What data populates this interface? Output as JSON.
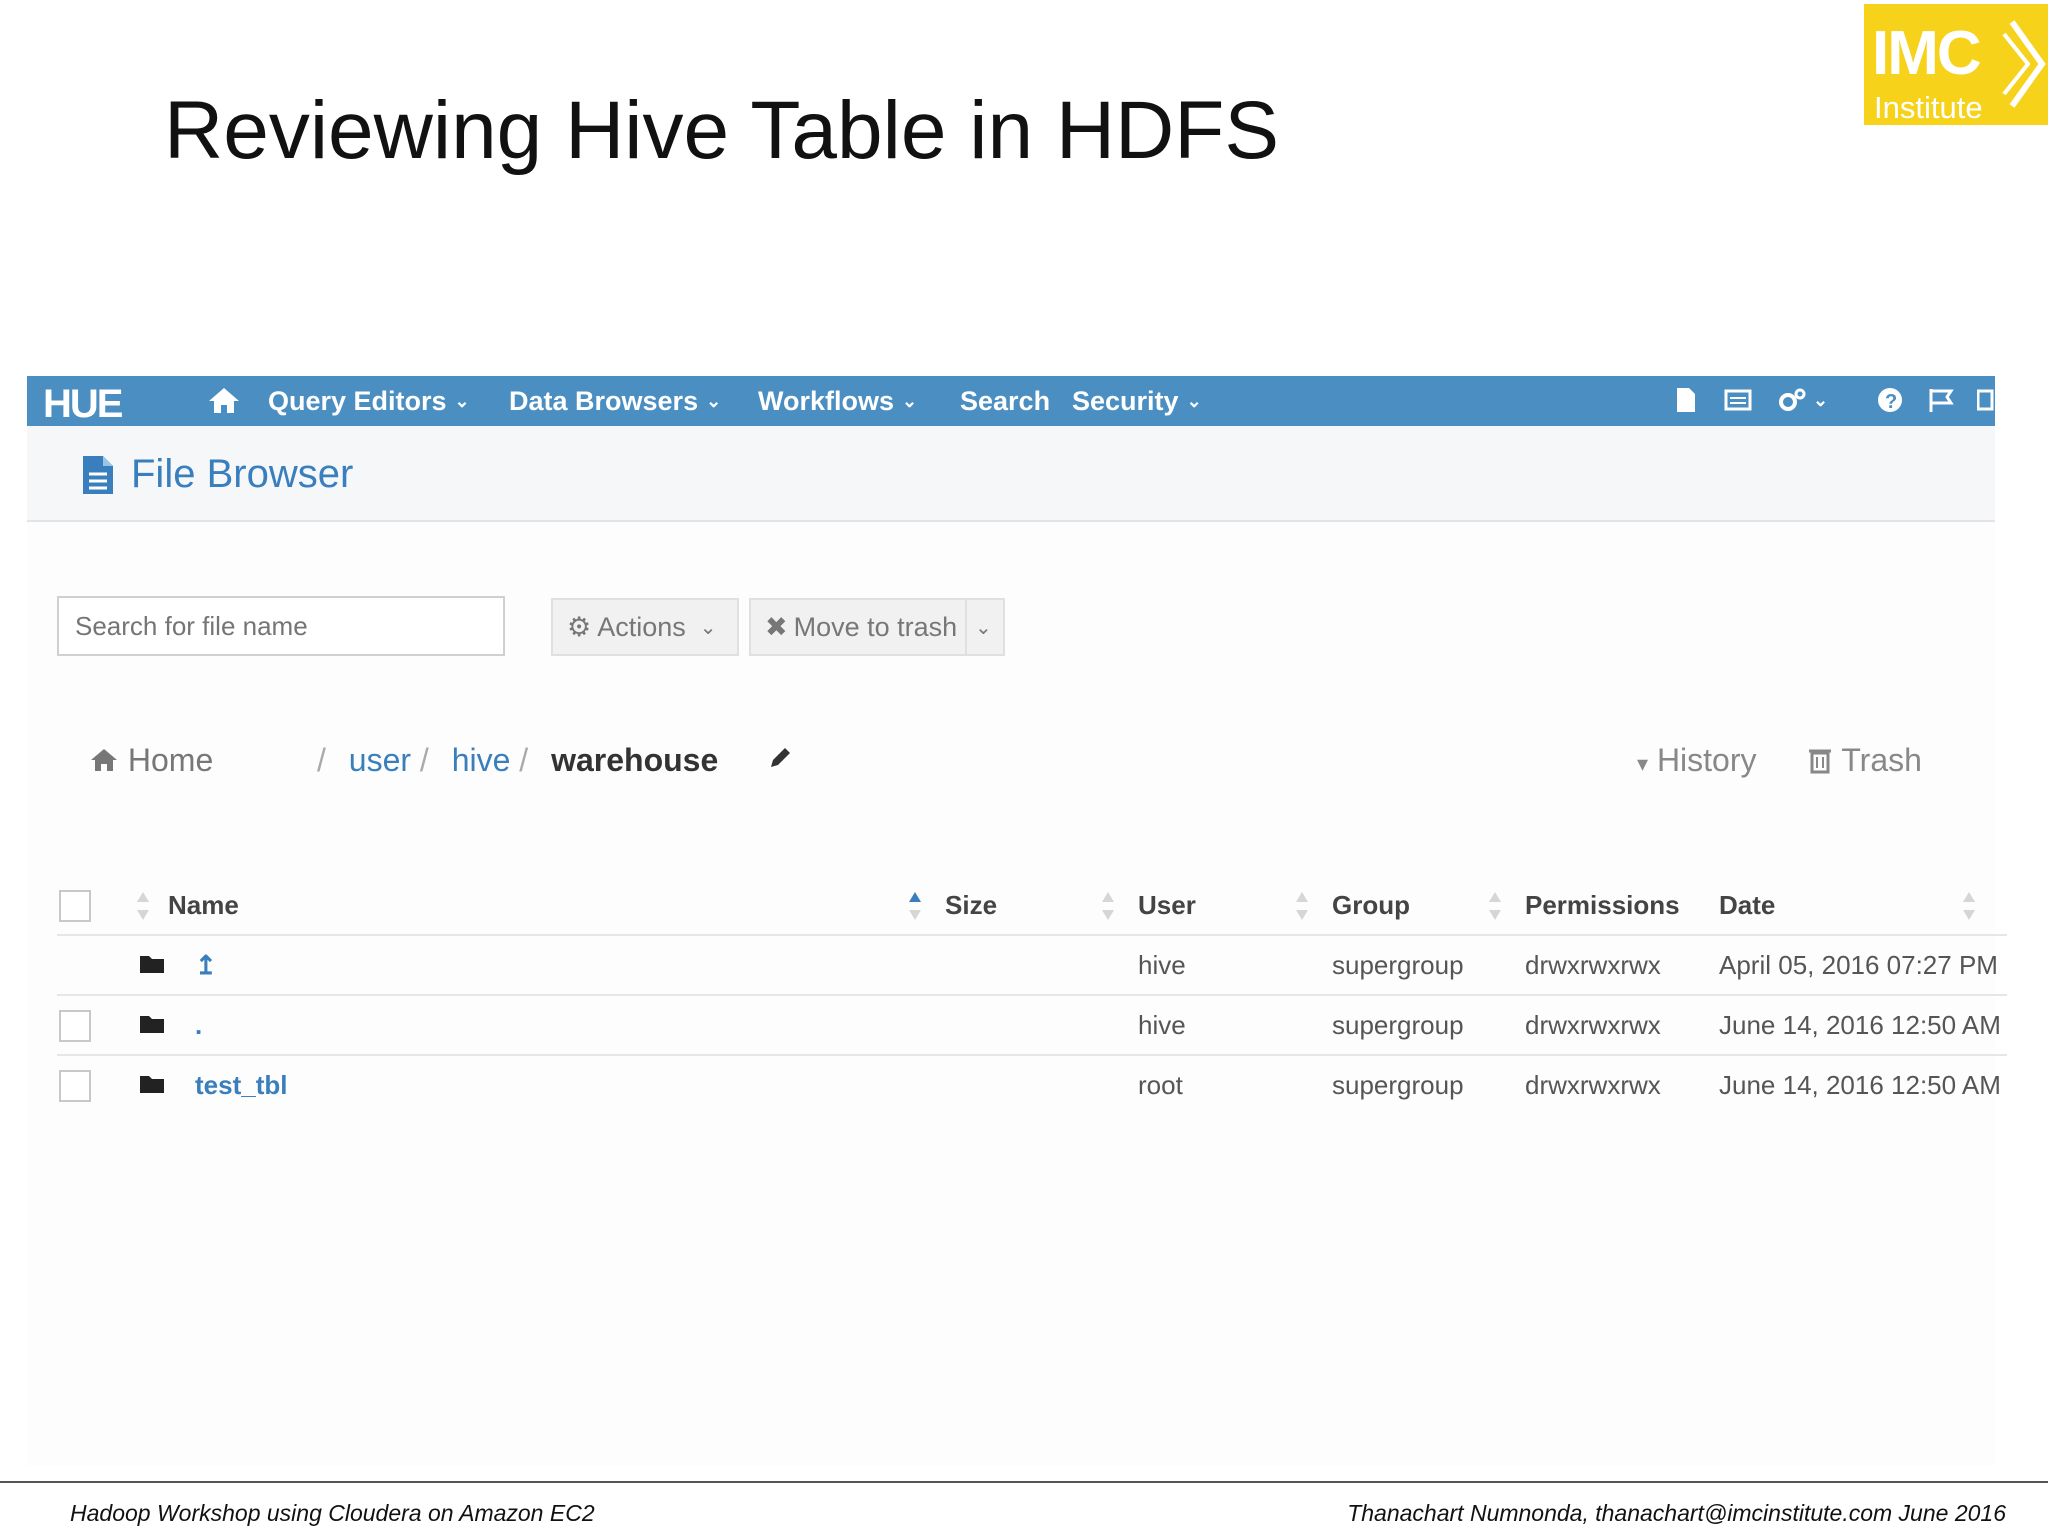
{
  "slide": {
    "title": "Reviewing Hive Table in HDFS",
    "logo_main": "IMC",
    "logo_sub": "Institute",
    "footer_left": "Hadoop Workshop using Cloudera on Amazon EC2",
    "footer_right": "Thanachart Numnonda,  thanachart@imcinstitute.com  June 2016"
  },
  "colors": {
    "nav_bg": "#4a8ec2",
    "link": "#3a7fbd",
    "logo_bg": "#f7d21a"
  },
  "navbar": {
    "brand": "HUE",
    "items": [
      "Query Editors",
      "Data Browsers",
      "Workflows",
      "Search",
      "Security"
    ],
    "icons": [
      "home-icon",
      "file-icon",
      "monitor-icon",
      "cogs-icon",
      "help-icon",
      "flag-icon",
      "logout-icon"
    ]
  },
  "file_browser": {
    "title": "File Browser",
    "search_placeholder": "Search for file name",
    "actions_label": "Actions",
    "move_to_trash_label": "Move to trash",
    "breadcrumb": {
      "home": "Home",
      "sep": "/",
      "parts": [
        "user",
        "hive",
        "warehouse"
      ]
    },
    "history_label": "History",
    "trash_label": "Trash"
  },
  "table": {
    "headers": [
      "Name",
      "Size",
      "User",
      "Group",
      "Permissions",
      "Date"
    ],
    "rows": [
      {
        "name": "↥",
        "size": "",
        "user": "hive",
        "group": "supergroup",
        "permissions": "drwxrwxrwx",
        "date": "April 05, 2016 07:27 PM"
      },
      {
        "name": ".",
        "size": "",
        "user": "hive",
        "group": "supergroup",
        "permissions": "drwxrwxrwx",
        "date": "June 14, 2016 12:50 AM"
      },
      {
        "name": "test_tbl",
        "size": "",
        "user": "root",
        "group": "supergroup",
        "permissions": "drwxrwxrwx",
        "date": "June 14, 2016 12:50 AM"
      }
    ]
  }
}
